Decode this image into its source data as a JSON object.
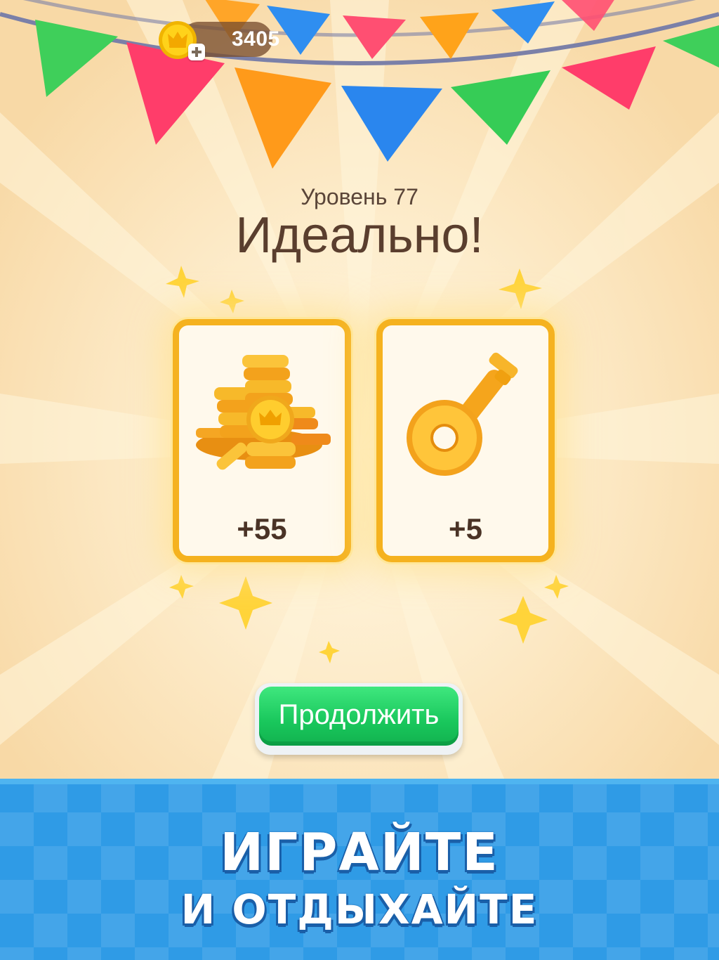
{
  "hud": {
    "coins": "3405",
    "coin_icon": "crown-coin-icon",
    "plus_icon": "plus-icon"
  },
  "level": {
    "label": "Уровень 77",
    "title": "Идеально!"
  },
  "rewards": [
    {
      "icon": "coin-pile-icon",
      "value": "+55"
    },
    {
      "icon": "key-icon",
      "value": "+5"
    }
  ],
  "continue": {
    "label": "Продолжить"
  },
  "banner": {
    "line1": "ИГРАЙТЕ",
    "line2": "И ОТДЫХАЙТЕ"
  },
  "colors": {
    "background": "#fdeccb",
    "card_border": "#f5b21f",
    "button_green": "#19c75c",
    "banner_blue": "#2f9be6",
    "text_brown": "#5a3e2e"
  }
}
